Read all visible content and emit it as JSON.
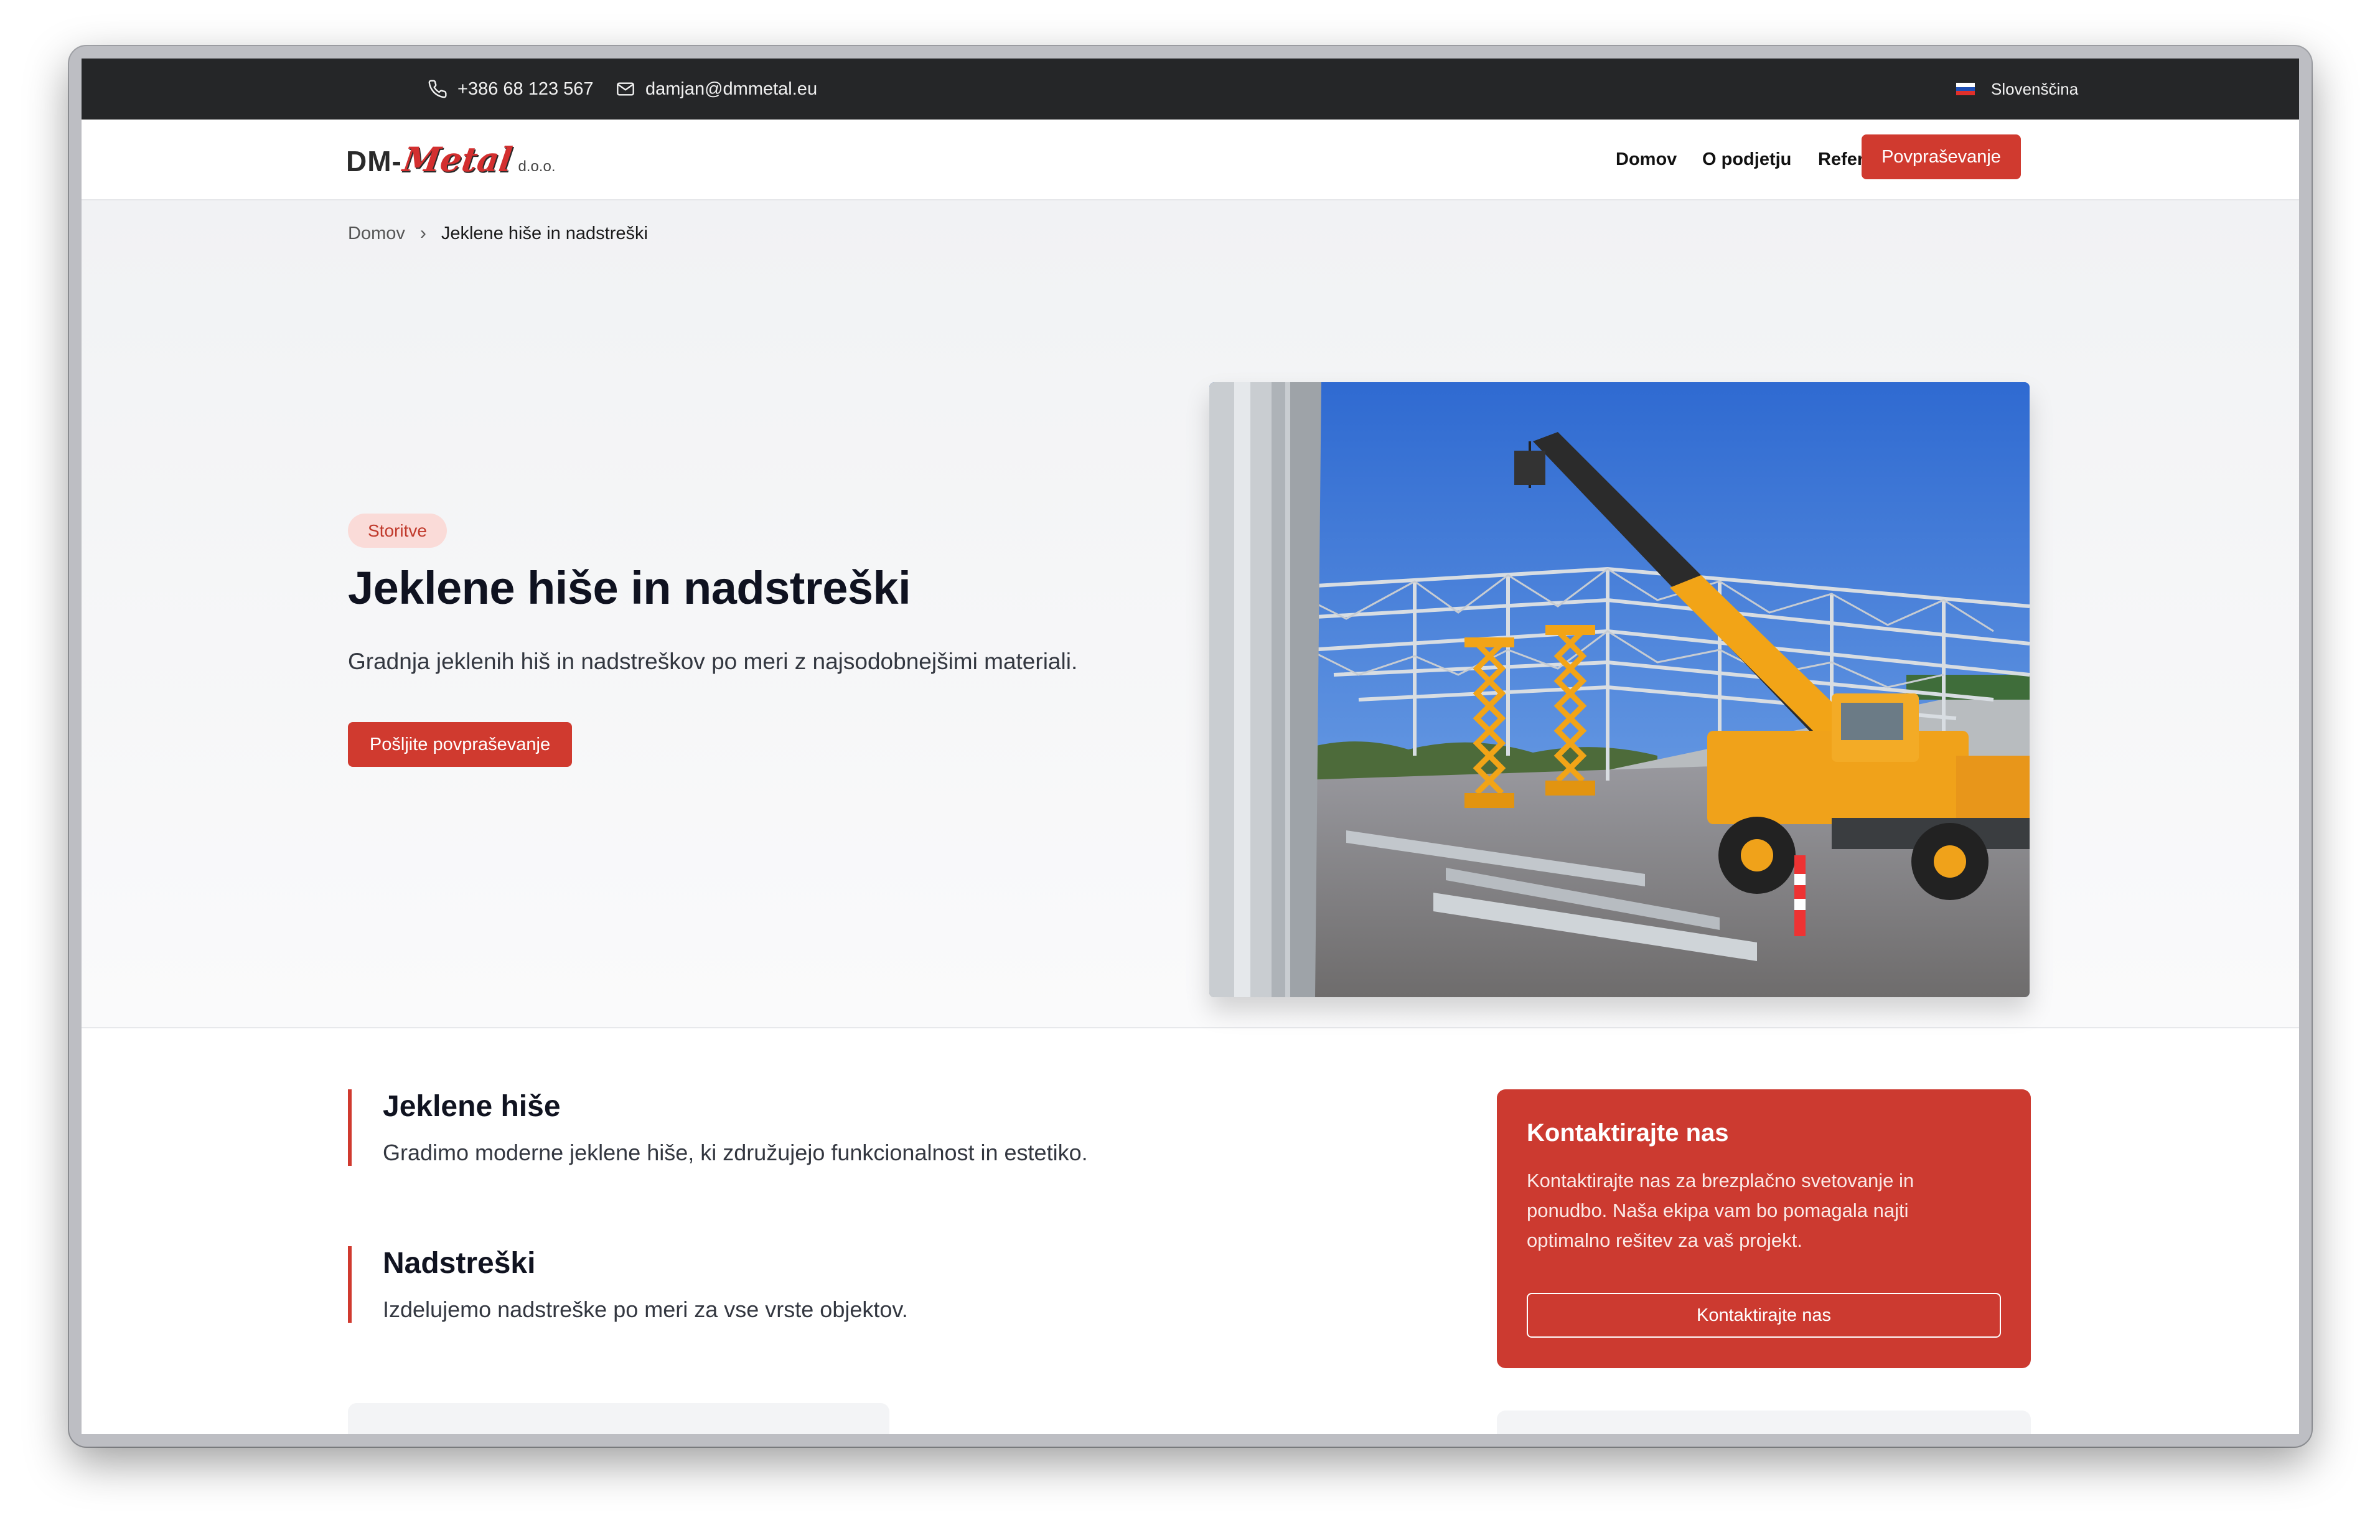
{
  "topbar": {
    "phone": "+386 68 123 567",
    "email": "damjan@dmmetal.eu",
    "language": "Slovenščina"
  },
  "logo": {
    "dm": "DM-",
    "metal": "Metal",
    "suffix": "d.o.o."
  },
  "nav": {
    "items": [
      "Domov",
      "O podjetju",
      "Reference"
    ],
    "cta": "Povpraševanje"
  },
  "breadcrumb": {
    "home": "Domov",
    "current": "Jeklene hiše in nadstreški"
  },
  "hero": {
    "badge": "Storitve",
    "title": "Jeklene hiše in nadstreški",
    "subtitle": "Gradnja jeklenih hiš in nadstreškov po meri z najsodobnejšimi materiali.",
    "button": "Pošljite povpraševanje"
  },
  "features": [
    {
      "title": "Jeklene hiše",
      "text": "Gradimo moderne jeklene hiše, ki združujejo funkcionalnost in estetiko."
    },
    {
      "title": "Nadstreški",
      "text": "Izdelujemo nadstreške po meri za vse vrste objektov."
    }
  ],
  "contact": {
    "title": "Kontaktirajte nas",
    "text": "Kontaktirajte nas za brezplačno svetovanje in ponudbo. Naša ekipa vam bo pomagala najti optimalno rešitev za vaš projekt.",
    "button": "Kontaktirajte nas"
  },
  "colors": {
    "accent": "#d03a2f",
    "topbar": "#252628",
    "badge_bg": "#fadbd8"
  }
}
